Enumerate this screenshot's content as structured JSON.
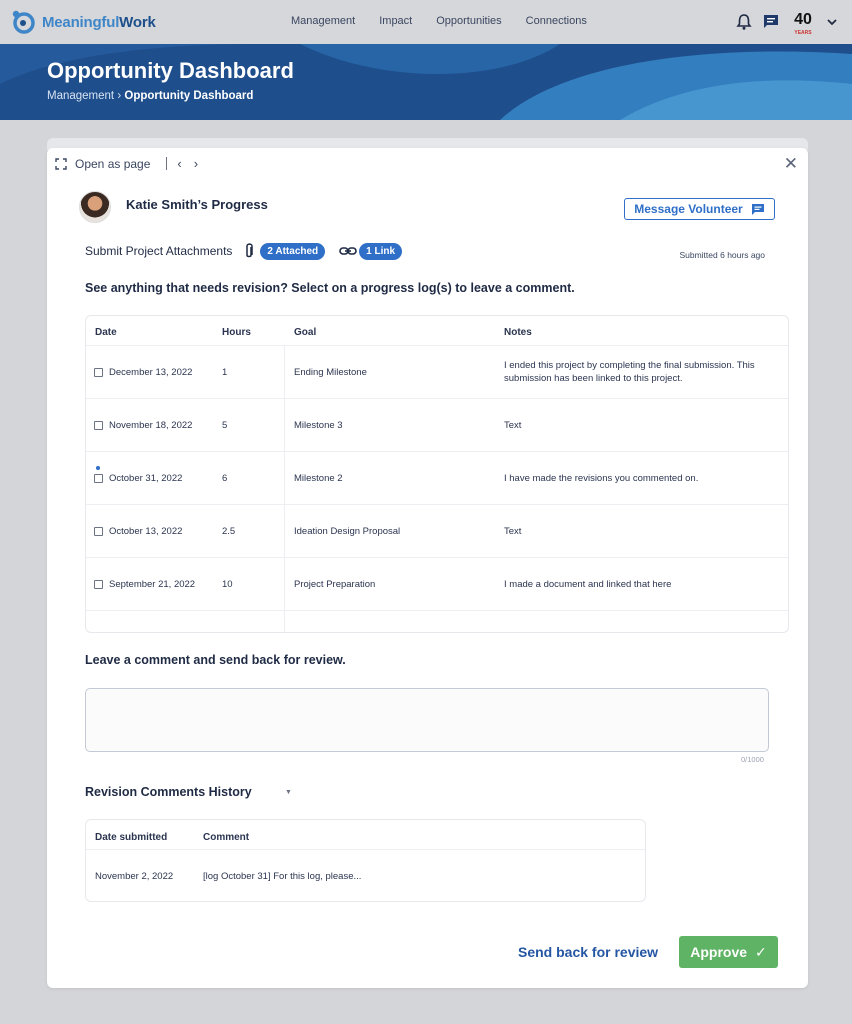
{
  "brand": {
    "part1": "Meaningful",
    "part2": "Work"
  },
  "nav": {
    "links": [
      "Management",
      "Impact",
      "Opportunities",
      "Connections"
    ]
  },
  "hero": {
    "title": "Opportunity Dashboard",
    "crumb_parent": "Management",
    "crumb_sep": "›",
    "crumb_current": "Opportunity Dashboard"
  },
  "badge": {
    "number": "40",
    "caption": "YEARS"
  },
  "panel": {
    "open_as_page": "Open as page",
    "volunteer_title": "Katie Smith’s Progress",
    "message_button": "Message Volunteer",
    "attachments_label": "Submit Project Attachments",
    "attached_pill": "2 Attached",
    "link_pill": "1 Link",
    "submitted_time": "Submitted 6 hours ago",
    "revision_prompt": "See anything that needs revision? Select on a progress log(s) to leave a comment."
  },
  "log_table": {
    "headers": {
      "date": "Date",
      "hours": "Hours",
      "goal": "Goal",
      "notes": "Notes"
    },
    "rows": [
      {
        "date": "December 13, 2022",
        "hours": "1",
        "goal": "Ending Milestone",
        "notes1": "I ended this project by completing the final submission. This",
        "notes2": "submission has been linked to this project."
      },
      {
        "date": "November 18, 2022",
        "hours": "5",
        "goal": "Milestone 3",
        "notes1": "Text",
        "notes2": ""
      },
      {
        "date": "October 31, 2022",
        "hours": "6",
        "goal": "Milestone 2",
        "notes1": "I have made the revisions you commented on.",
        "notes2": ""
      },
      {
        "date": "October 13, 2022",
        "hours": "2.5",
        "goal": "Ideation Design Proposal",
        "notes1": "Text",
        "notes2": ""
      },
      {
        "date": "September 21, 2022",
        "hours": "10",
        "goal": "Project Preparation",
        "notes1": "I made a document and linked that here",
        "notes2": ""
      }
    ]
  },
  "comment": {
    "label": "Leave a comment and send back for review.",
    "value": "",
    "counter": "0/1000"
  },
  "history": {
    "title": "Revision Comments History",
    "headers": {
      "date": "Date submitted",
      "comment": "Comment"
    },
    "rows": [
      {
        "date": "November 2, 2022",
        "comment": "[log October 31] For this log, please..."
      }
    ]
  },
  "actions": {
    "send_back": "Send back for review",
    "approve": "Approve",
    "approve_check": "✓"
  },
  "colors": {
    "primary": "#2f6fc7",
    "hero": "#1e4e8c",
    "approve": "#5fb364",
    "brand_light": "#3f86c8"
  }
}
